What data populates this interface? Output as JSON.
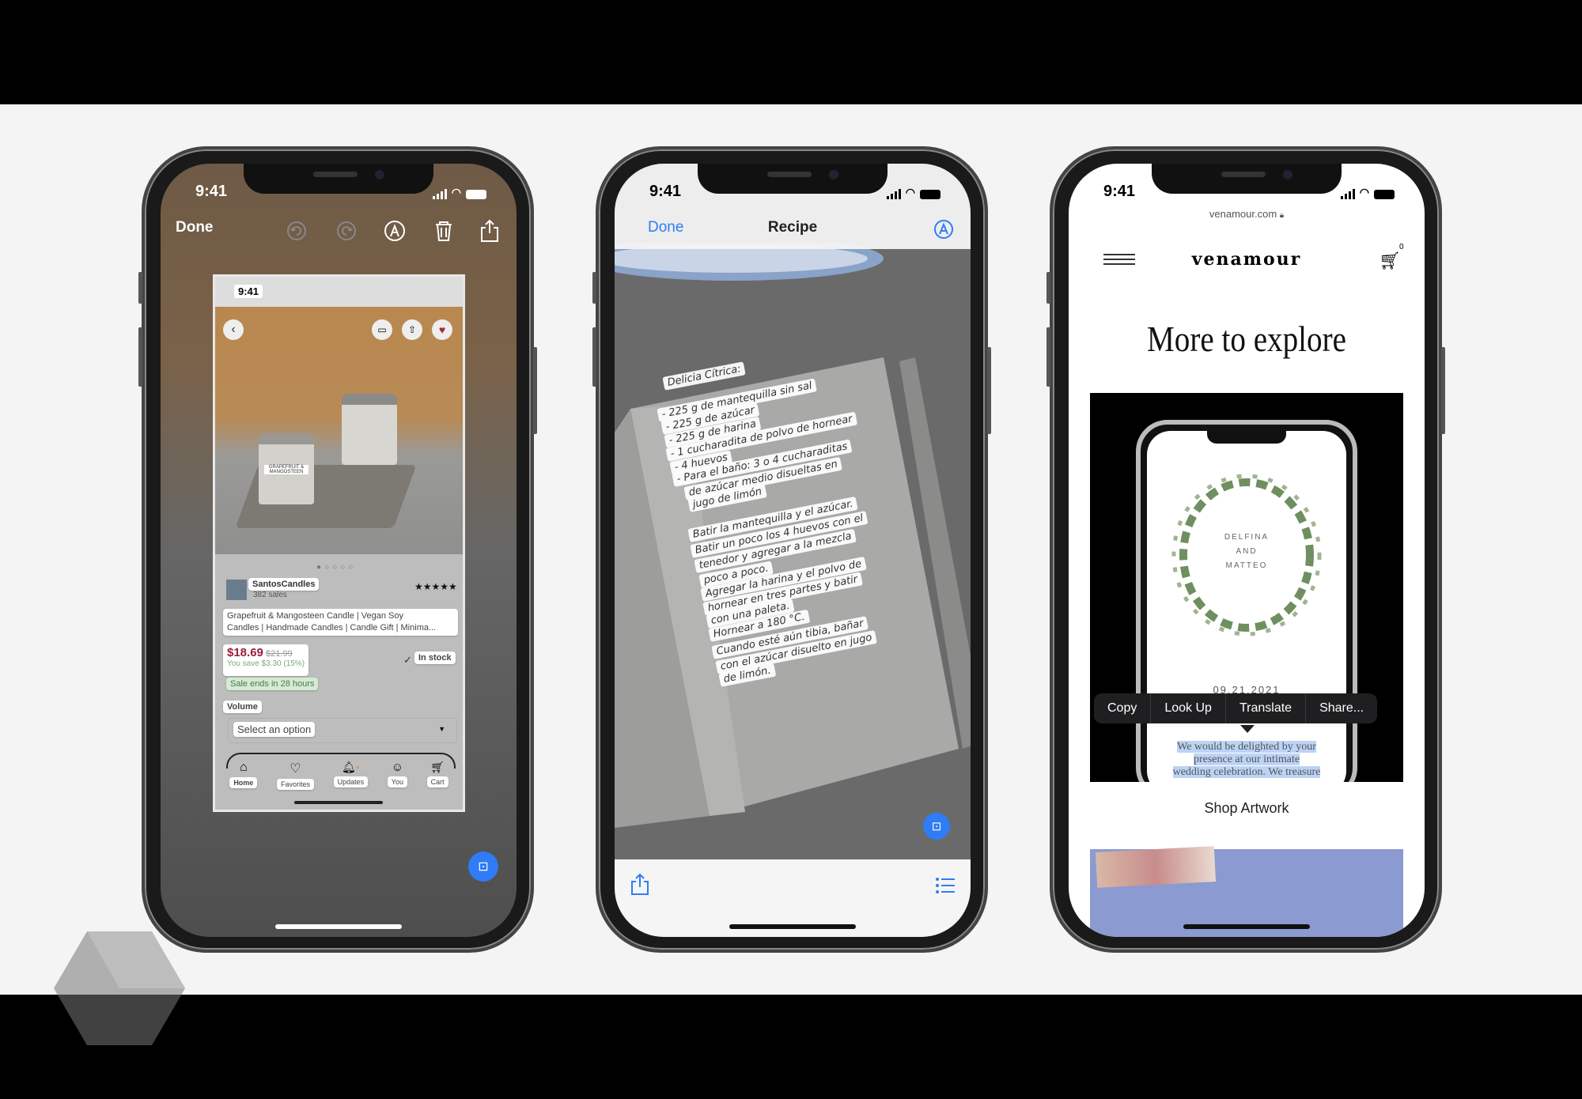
{
  "status_time": "9:41",
  "colors": {
    "ios_blue": "#2f7cf6",
    "price_red": "#9b1c3c",
    "save_green": "#5a9a5a",
    "menu_bg": "#1f1f21",
    "selection": "#bcd3f5"
  },
  "phone1": {
    "done_label": "Done",
    "toolbar_icons": [
      "undo-icon",
      "redo-icon",
      "markup-icon",
      "trash-icon",
      "share-icon"
    ],
    "screenshot": {
      "time": "9:41",
      "seller_name": "SantosCandles",
      "seller_sales": "382 sales",
      "rating_stars": "★★★★★",
      "product_title_line1": "Grapefruit & Mangosteen Candle | Vegan Soy",
      "product_title_line2": "Candles | Handmade Candles | Candle Gift | Minima...",
      "price": "$18.69",
      "original_price": "$21.99",
      "savings": "You save $3.30 (15%)",
      "stock": "In stock",
      "sale_notice": "Sale ends in 28 hours",
      "volume_label": "Volume",
      "select_placeholder": "Select an option",
      "jar_label": "GRAPEFRUIT & MANGOSTEEN",
      "tabs": [
        "Home",
        "Favorites",
        "Updates",
        "You",
        "Cart"
      ]
    }
  },
  "phone2": {
    "done_label": "Done",
    "title": "Recipe",
    "recipe_lines": [
      "Delicia Cítrica:",
      "- 225 g de mantequilla sin sal",
      "- 225 g de azúcar",
      "- 225 g de harina",
      "- 1 cucharadita de polvo de hornear",
      "- 4 huevos",
      "- Para el baño: 3 o 4 cucharaditas",
      "de azúcar medio disueltas en",
      "jugo de limón",
      "Batir la mantequilla y el azúcar.",
      "Batir un poco los 4 huevos con el",
      "tenedor y agregar a la mezcla",
      "poco a poco.",
      "Agregar la harina y el polvo de",
      "hornear en tres partes y batir",
      "con una paleta.",
      "Hornear a 180 °C.",
      "Cuando esté aún tibia, bañar",
      "con el azúcar disuelto en jugo",
      "de limón."
    ]
  },
  "phone3": {
    "url": "venamour.com",
    "logo": "venamour",
    "cart_count": "0",
    "heading": "More to explore",
    "card_names": [
      "DELFINA",
      "AND",
      "MATTEO"
    ],
    "card_date": "09.21.2021",
    "context_menu": [
      "Copy",
      "Look Up",
      "Translate",
      "Share..."
    ],
    "selected_text": [
      "We would be delighted by your",
      "presence at our intimate",
      "wedding celebration. We treasure"
    ],
    "shop_link": "Shop Artwork"
  }
}
